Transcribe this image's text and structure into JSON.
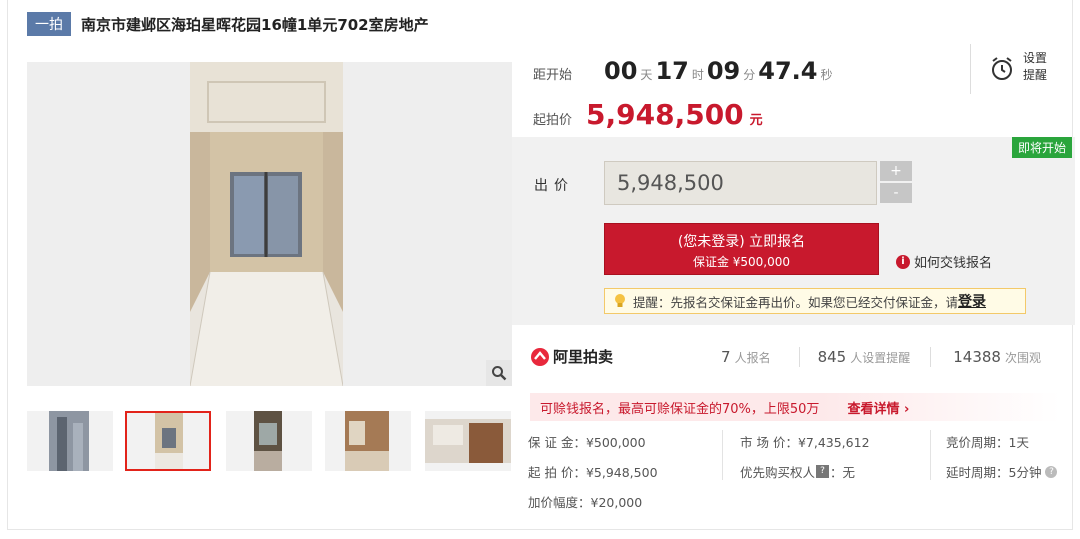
{
  "header": {
    "round_tag": "一拍",
    "title": "南京市建邺区海珀星晖花园16幢1单元702室房地产"
  },
  "countdown": {
    "label": "距开始",
    "days": "00",
    "days_unit": "天",
    "hours": "17",
    "hours_unit": "时",
    "minutes": "09",
    "minutes_unit": "分",
    "seconds": "47.4",
    "seconds_unit": "秒"
  },
  "reminder": {
    "label": "设置\n提醒",
    "icon": "alarm-clock-icon"
  },
  "start_price": {
    "label": "起拍价",
    "value": "5,948,500",
    "unit": "元"
  },
  "bid": {
    "status_badge": "即将开始",
    "label": "出价",
    "input_value": "5,948,500",
    "plus": "+",
    "minus": "-",
    "signup_main": "(您未登录) 立即报名",
    "signup_sub": "保证金 ¥500,000",
    "howto": "如何交钱报名",
    "notice": "提醒：先报名交保证金再出价。如果您已经交付保证金，请",
    "notice_link": "登录"
  },
  "stats": {
    "brand": "阿里拍卖",
    "signups": "7",
    "signups_label": "人报名",
    "reminders": "845",
    "reminders_label": "人设置提醒",
    "views": "14388",
    "views_label": "次围观"
  },
  "promo": {
    "text": "可赊钱报名，最高可赊保证金的70%，上限50万",
    "link": "查看详情 ›"
  },
  "details": {
    "deposit": "保 证 金：¥500,000",
    "start": "起 拍 价：¥5,948,500",
    "increment": "加价幅度：¥20,000",
    "market": "市 场 价：¥7,435,612",
    "priority": "优先购买权人",
    "priority_value": "：无",
    "cycle": "竞价周期：1天",
    "delay": "延时周期：5分钟"
  },
  "colors": {
    "accent": "#c8192d",
    "tag": "#5b7aa8",
    "badge": "#2aa53c"
  }
}
